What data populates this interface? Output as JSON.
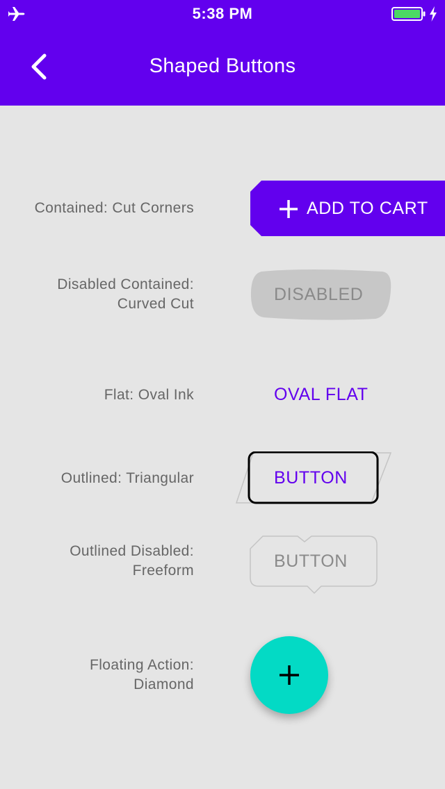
{
  "status_bar": {
    "time": "5:38 PM",
    "icons": [
      "airplane-icon",
      "battery-icon",
      "charging-bolt-icon"
    ]
  },
  "header": {
    "title": "Shaped Buttons",
    "back_icon": "chevron-left-icon"
  },
  "rows": {
    "contained_cut": {
      "label": "Contained: Cut Corners",
      "button": "ADD TO CART",
      "icon": "plus-icon"
    },
    "disabled_curved": {
      "label_line1": "Disabled Contained:",
      "label_line2": "Curved Cut",
      "button": "DISABLED"
    },
    "flat_oval": {
      "label": "Flat: Oval Ink",
      "button": "OVAL FLAT"
    },
    "outlined_triangular": {
      "label": "Outlined: Triangular",
      "button": "BUTTON"
    },
    "outlined_disabled": {
      "label_line1": "Outlined Disabled:",
      "label_line2": "Freeform",
      "button": "BUTTON"
    },
    "fab": {
      "label_line1": "Floating Action:",
      "label_line2": "Diamond",
      "icon": "plus-icon"
    }
  },
  "colors": {
    "primary": "#6200ee",
    "secondary": "#03dac5",
    "background": "#e5e5e5",
    "disabled_fill": "#c7c7c7",
    "disabled_text": "#8a8a8a",
    "label_text": "#666666"
  }
}
